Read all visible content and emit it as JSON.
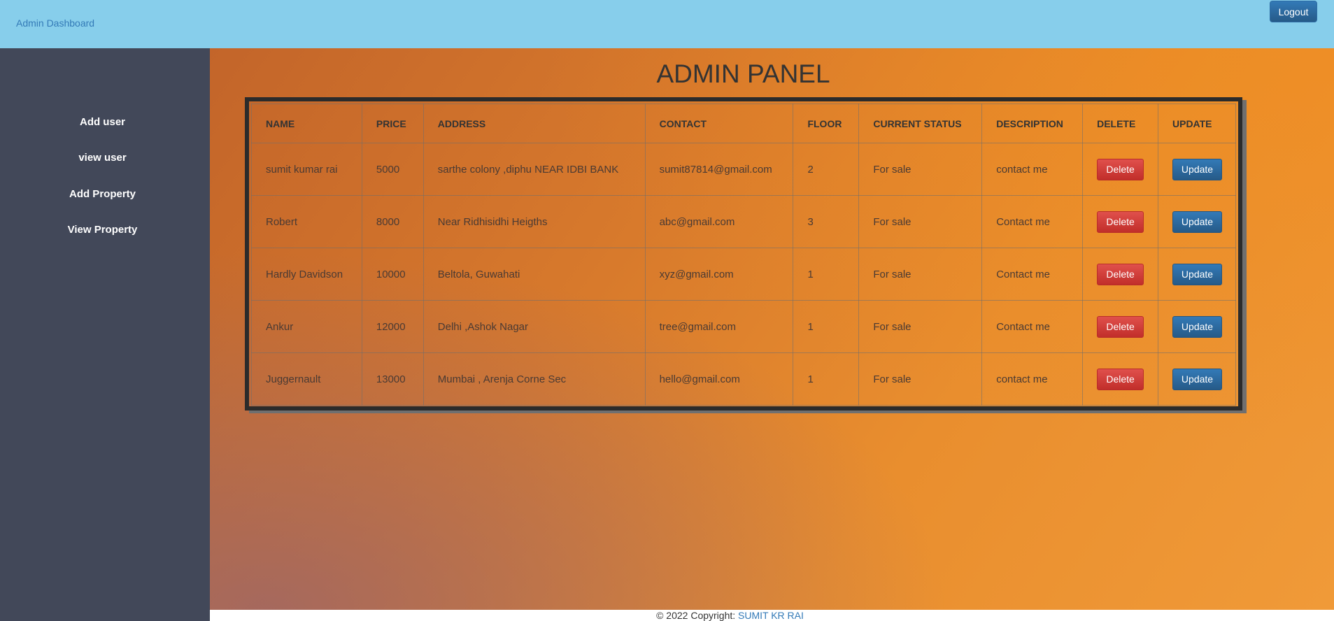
{
  "header": {
    "brand": "Admin Dashboard",
    "logout_label": "Logout"
  },
  "sidebar": {
    "items": [
      {
        "label": "Add user"
      },
      {
        "label": "view user"
      },
      {
        "label": "Add Property"
      },
      {
        "label": "View Property"
      }
    ]
  },
  "main": {
    "title": "ADMIN PANEL"
  },
  "table": {
    "headers": [
      "NAME",
      "PRICE",
      "ADDRESS",
      "CONTACT",
      "FLOOR",
      "CURRENT STATUS",
      "DESCRIPTION",
      "DELETE",
      "UPDATE"
    ],
    "delete_label": "Delete",
    "update_label": "Update",
    "rows": [
      {
        "name": "sumit kumar rai",
        "price": "5000",
        "address": "sarthe colony ,diphu NEAR IDBI BANK",
        "contact": "sumit87814@gmail.com",
        "floor": "2",
        "status": "For sale",
        "description": "contact me"
      },
      {
        "name": "Robert",
        "price": "8000",
        "address": "Near Ridhisidhi Heigths",
        "contact": "abc@gmail.com",
        "floor": "3",
        "status": "For sale",
        "description": "Contact me"
      },
      {
        "name": "Hardly Davidson",
        "price": "10000",
        "address": "Beltola, Guwahati",
        "contact": "xyz@gmail.com",
        "floor": "1",
        "status": "For sale",
        "description": "Contact me"
      },
      {
        "name": "Ankur",
        "price": "12000",
        "address": "Delhi ,Ashok Nagar",
        "contact": "tree@gmail.com",
        "floor": "1",
        "status": "For sale",
        "description": "Contact me"
      },
      {
        "name": "Juggernault",
        "price": "13000",
        "address": "Mumbai , Arenja Corne Sec",
        "contact": "hello@gmail.com",
        "floor": "1",
        "status": "For sale",
        "description": "contact me"
      }
    ]
  },
  "footer": {
    "text": "© 2022 Copyright: ",
    "link": "SUMIT KR RAI"
  }
}
